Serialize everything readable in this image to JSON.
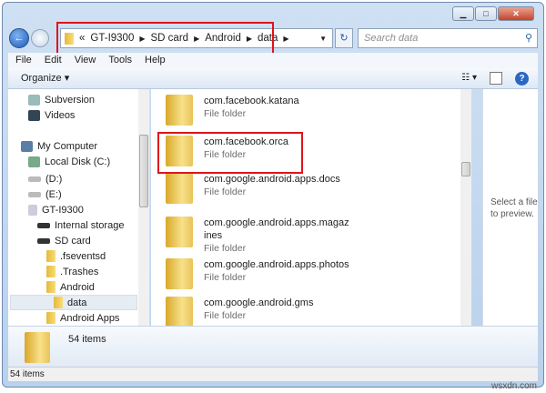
{
  "address": {
    "overflow": "«",
    "crumbs": [
      "GT-I9300",
      "SD card",
      "Android",
      "data"
    ]
  },
  "search": {
    "placeholder": "Search data"
  },
  "menu": [
    "File",
    "Edit",
    "View",
    "Tools",
    "Help"
  ],
  "toolbar": {
    "organize": "Organize ▾"
  },
  "nav": [
    "Subversion",
    "Videos",
    "My Computer",
    "Local Disk (C:)",
    "(D:)",
    "(E:)",
    "GT-I9300",
    "Internal storage",
    "SD card",
    ".fseventsd",
    ".Trashes",
    "Android",
    "data",
    "Android Apps"
  ],
  "files": [
    {
      "name": "com.facebook.katana",
      "type": "File folder"
    },
    {
      "name": "com.facebook.orca",
      "type": "File folder"
    },
    {
      "name": "com.google.android.apps.docs",
      "type": "File folder"
    },
    {
      "name": "com.google.android.apps.magazines",
      "type": "File folder"
    },
    {
      "name": "com.google.android.apps.photos",
      "type": "File folder"
    },
    {
      "name": "com.google.android.gms",
      "type": "File folder"
    }
  ],
  "preview": "Select a file to preview.",
  "details": {
    "count": "54 items"
  },
  "status": "54 items",
  "watermark": "wsxdn.com",
  "colors": {
    "highlight": "#e0131b"
  }
}
